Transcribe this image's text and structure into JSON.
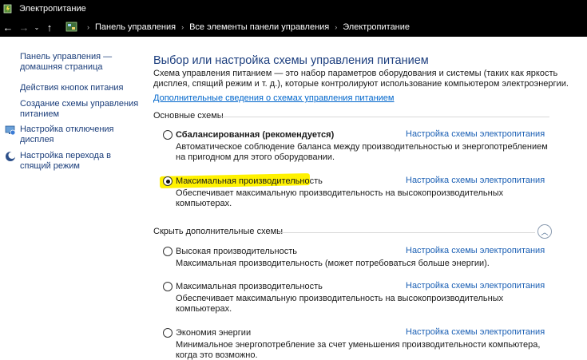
{
  "window": {
    "title": "Электропитание"
  },
  "nav": {
    "back_glyph": "←",
    "forward_glyph": "→",
    "dropdown_glyph": "⌄",
    "up_glyph": "↑",
    "breadcrumbs": [
      "Панель управления",
      "Все элементы панели управления",
      "Электропитание"
    ],
    "separator": "›"
  },
  "sidebar": {
    "items": [
      {
        "label_line1": "Панель управления —",
        "label_line2": "домашняя страница",
        "icon": null
      },
      {
        "label_line1": "Действия кнопок питания",
        "label_line2": "",
        "icon": null
      },
      {
        "label_line1": "Создание схемы управления",
        "label_line2": "питанием",
        "icon": null
      },
      {
        "label_line1": "Настройка отключения",
        "label_line2": "дисплея",
        "icon": "display-icon"
      },
      {
        "label_line1": "Настройка перехода в",
        "label_line2": "спящий режим",
        "icon": "moon-icon"
      }
    ]
  },
  "main": {
    "title": "Выбор или настройка схемы управления питанием",
    "description_line1": "Схема управления питанием — это набор параметров оборудования и системы (таких как яркость",
    "description_line2": "дисплея, спящий режим и т. д.), которые контролируют использование компьютером электроэнергии.",
    "more_link": "Дополнительные сведения о схемах управления питанием",
    "basic_group_label": "Основные схемы",
    "hidden_group_label": "Скрыть дополнительные схемы",
    "collapse_glyph": "︿",
    "plans_basic": [
      {
        "name": "Сбалансированная (рекомендуется)",
        "bold": true,
        "checked": false,
        "link": "Настройка схемы электропитания",
        "desc_line1": "Автоматическое соблюдение баланса между производительностью и энергопотреблением",
        "desc_line2": "на пригодном для этого оборудовании."
      },
      {
        "name": "Максимальная производительность",
        "bold": false,
        "checked": true,
        "link": "Настройка схемы электропитания",
        "desc_line1": "Обеспечивает максимальную производительность на высокопроизводительных",
        "desc_line2": "компьютерах."
      }
    ],
    "plans_hidden": [
      {
        "name": "Высокая производительность",
        "checked": false,
        "link": "Настройка схемы электропитания",
        "desc_line1": "Максимальная производительность (может потребоваться больше энергии).",
        "desc_line2": ""
      },
      {
        "name": "Максимальная производительность",
        "checked": false,
        "link": "Настройка схемы электропитания",
        "desc_line1": "Обеспечивает максимальную производительность на высокопроизводительных",
        "desc_line2": "компьютерах."
      },
      {
        "name": "Экономия энергии",
        "checked": false,
        "link": "Настройка схемы электропитания",
        "desc_line1": "Минимальное энергопотребление за счет уменьшения производительности компьютера,",
        "desc_line2": "когда это возможно."
      }
    ]
  },
  "colors": {
    "highlight": "#fff200",
    "link": "#1a5fb4",
    "title": "#1c3e7e",
    "sidebar_link": "#1a3d7a"
  }
}
